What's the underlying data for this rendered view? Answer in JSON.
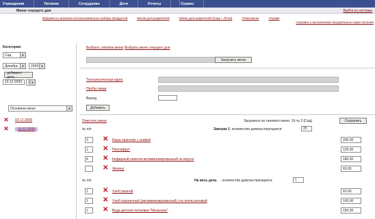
{
  "topnav": [
    "Учреждения",
    "Питание",
    "Сотрудники",
    "Дети",
    "Отчеты",
    "Сервис"
  ],
  "header": {
    "title": "Меню текущего дня",
    "logout": "Выйти из системы"
  },
  "menus": [
    "Ведомость анализа использованного набора продуктов",
    "Меню для родителей",
    "Меню для родителей (Сад + Ясли)",
    "Тема-меню",
    "Справк"
  ],
  "report_link": "Справка о выполнении натуральных норм питания",
  "left": {
    "category_label": "Категория",
    "category": "Сад",
    "month": "Декабрь",
    "year": "2009",
    "add_day_btn": "добавить день",
    "date_input": "10.12.2009",
    "time": "00",
    "menu_type": "Основное меню",
    "dates": [
      {
        "label": "03.12.2009"
      },
      {
        "label": "10.12.2009"
      }
    ]
  },
  "main": {
    "pick_standard": "Выбрать типовое меню",
    "pick_today": "Выбрать меню текущего дня",
    "load_btn": "Загрузить меню",
    "tech_card": "Технологическая карта",
    "recipe": "Пробы пищи",
    "output_label": "Выход",
    "add_btn": "Добавить",
    "clear_link": "Очистить меню",
    "loaded_text": "Загружено из типового меню: 10-ть 3 (Сад)",
    "save_btn": "Сохранить",
    "num_header": "№ п/п",
    "section1_label": "Завтрак 1",
    "section1_suffix": " - количество довольствующихся:",
    "section1_count": "25",
    "section2_label": "На весь день",
    "section2_suffix": " - количество довольствующихся:",
    "section2_count": "1",
    "items1": [
      {
        "qty": "3",
        "name": "Каша пшенная с тыквой",
        "price": "200.00"
      },
      {
        "qty": "1",
        "name": "Пепсифрут",
        "price": "125.00"
      },
      {
        "qty": "4",
        "name": "Кефирный напиток витаминизированный не вкусно",
        "price": "180.00"
      },
      {
        "qty": "",
        "name": "Жемчуг",
        "price": "60.00"
      }
    ],
    "items2": [
      {
        "qty": "1",
        "name": "Хлеб ржаной",
        "price": "60.00"
      },
      {
        "qty": "1",
        "name": "Хлеб пшеничный (витаминизированный) сок апельсиновый",
        "price": "165.00"
      },
      {
        "qty": "1",
        "name": "Вода детская питьевая \"Малышок\"",
        "price": "150.00"
      }
    ]
  }
}
